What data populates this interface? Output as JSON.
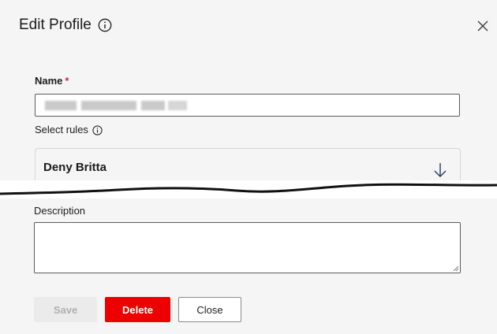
{
  "dialog": {
    "title": "Edit Profile",
    "title_icon": "info-icon",
    "close_icon": "close-icon"
  },
  "form": {
    "name_label": "Name",
    "name_required_mark": "*",
    "name_value_redacted": true,
    "select_rules_label": "Select rules",
    "select_rules_icon": "info-icon",
    "selected_rule": "Deny Britta",
    "rule_expand_icon": "arrow-down-icon",
    "description_label": "Description",
    "description_value": ""
  },
  "buttons": {
    "save_label": "Save",
    "save_enabled": false,
    "delete_label": "Delete",
    "close_label": "Close"
  },
  "colors": {
    "panel_bg": "#f5f5f5",
    "delete_bg": "#ee0000",
    "required_mark": "#c4314b",
    "disabled_bg": "#ebebeb",
    "disabled_text": "#b0b0b0"
  }
}
